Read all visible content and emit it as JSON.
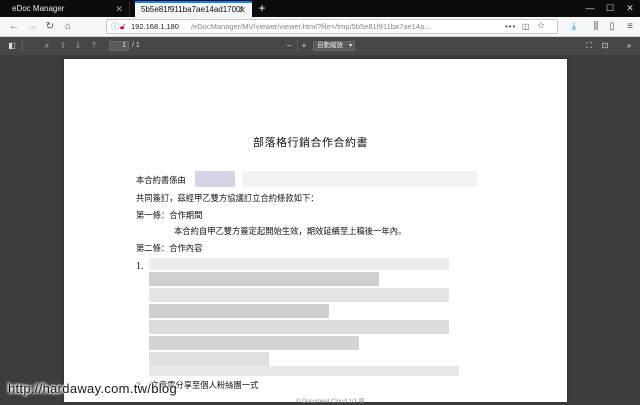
{
  "browser": {
    "tabs": [
      {
        "title": "eDoc Manager"
      },
      {
        "title": "5b5e81f911ba7ae14ad1700f"
      }
    ],
    "url": {
      "host": "192.168.1.180",
      "path": "/eDocManager/MV/viewer/viewer.html?file=/tmp/5b5e81f911ba7ae14a...",
      "menu_dots": "•••"
    }
  },
  "pdf_toolbar": {
    "page_number": "1",
    "page_count": "/ 1",
    "zoom_label": "自動縮放"
  },
  "document": {
    "title": "部落格行銷合作合約書",
    "line1_prefix": "本合約書係由",
    "line2": "共同簽訂，茲經甲乙雙方協議訂立合約條款如下：",
    "article1_heading": "第一條：合作期間",
    "article1_body": "本合約自甲乙雙方簽定起開始生效，期效延續至上稿後一年內。",
    "article2_heading": "第二條：合作內容",
    "item1_number": "1.",
    "item2": "2.　文章需分享至個人粉絲團一式",
    "footer_text": "© Document Cloud 1/1 頁"
  },
  "watermark": "http://hardaway.com.tw/blog"
}
